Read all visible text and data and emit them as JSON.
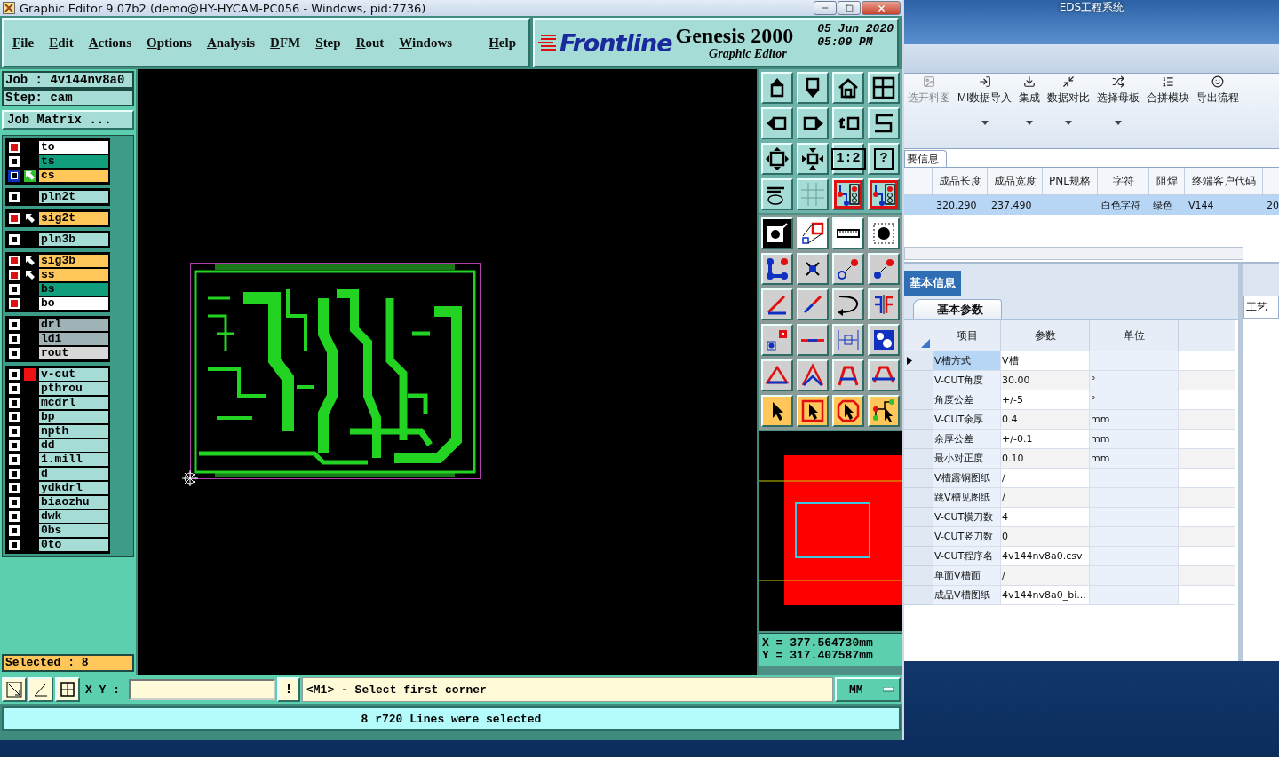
{
  "genesis": {
    "title": "Graphic Editor 9.07b2 (demo@HY-HYCAM-PC056 - Windows, pid:7736)",
    "menu": [
      "File",
      "Edit",
      "Actions",
      "Options",
      "Analysis",
      "DFM",
      "Step",
      "Rout",
      "Windows"
    ],
    "help": "Help",
    "brand": {
      "logo": "Frontline",
      "product": "Genesis 2000",
      "subtitle": "Graphic Editor",
      "date": "05 Jun 2020",
      "time": "05:09 PM"
    },
    "job": "Job : 4v144nv8a0",
    "step": "Step: cam",
    "job_matrix": "Job Matrix ...",
    "layer_groups": [
      {
        "layers": [
          {
            "name": "to",
            "checked": true,
            "affected": false,
            "work": false,
            "flagged": false,
            "color": "#ffffff"
          },
          {
            "name": "ts",
            "checked": false,
            "affected": false,
            "work": false,
            "flagged": false,
            "color": "#119e7c"
          },
          {
            "name": "cs",
            "checked": false,
            "affected": true,
            "work": true,
            "flagged": false,
            "color": "#ffc65a"
          }
        ]
      },
      {
        "layers": [
          {
            "name": "pln2t",
            "checked": false,
            "affected": false,
            "work": false,
            "flagged": false,
            "color": "#a6dcd6"
          }
        ]
      },
      {
        "layers": [
          {
            "name": "sig2t",
            "checked": true,
            "affected": true,
            "work": false,
            "flagged": false,
            "color": "#ffc65a"
          }
        ]
      },
      {
        "layers": [
          {
            "name": "pln3b",
            "checked": false,
            "affected": false,
            "work": false,
            "flagged": false,
            "color": "#a6dcd6"
          }
        ]
      },
      {
        "layers": [
          {
            "name": "sig3b",
            "checked": true,
            "affected": true,
            "work": false,
            "flagged": false,
            "color": "#ffc65a"
          },
          {
            "name": "ss",
            "checked": true,
            "affected": true,
            "work": false,
            "flagged": false,
            "color": "#ffc65a"
          },
          {
            "name": "bs",
            "checked": false,
            "affected": false,
            "work": false,
            "flagged": false,
            "color": "#119e7c"
          },
          {
            "name": "bo",
            "checked": true,
            "affected": false,
            "work": false,
            "flagged": false,
            "color": "#ffffff"
          }
        ]
      },
      {
        "layers": [
          {
            "name": "drl",
            "checked": false,
            "affected": false,
            "work": false,
            "flagged": false,
            "color": "#9fb2b6"
          },
          {
            "name": "ldi",
            "checked": false,
            "affected": false,
            "work": false,
            "flagged": false,
            "color": "#9fb2b6"
          },
          {
            "name": "rout",
            "checked": false,
            "affected": false,
            "work": false,
            "flagged": false,
            "color": "#d8d8d8"
          }
        ]
      },
      {
        "layers": [
          {
            "name": "v-cut",
            "checked": false,
            "affected": false,
            "work": false,
            "flagged": true,
            "color": "#a6dcd6"
          },
          {
            "name": "pthrou",
            "checked": false,
            "affected": false,
            "work": false,
            "flagged": false,
            "color": "#a6dcd6"
          },
          {
            "name": "mcdrl",
            "checked": false,
            "affected": false,
            "work": false,
            "flagged": false,
            "color": "#a6dcd6"
          },
          {
            "name": "bp",
            "checked": false,
            "affected": false,
            "work": false,
            "flagged": false,
            "color": "#a6dcd6"
          },
          {
            "name": "npth",
            "checked": false,
            "affected": false,
            "work": false,
            "flagged": false,
            "color": "#a6dcd6"
          },
          {
            "name": "dd",
            "checked": false,
            "affected": false,
            "work": false,
            "flagged": false,
            "color": "#a6dcd6"
          },
          {
            "name": "1.mill",
            "checked": false,
            "affected": false,
            "work": false,
            "flagged": false,
            "color": "#a6dcd6"
          },
          {
            "name": "d",
            "checked": false,
            "affected": false,
            "work": false,
            "flagged": false,
            "color": "#a6dcd6"
          },
          {
            "name": "ydkdrl",
            "checked": false,
            "affected": false,
            "work": false,
            "flagged": false,
            "color": "#a6dcd6"
          },
          {
            "name": "biaozhu",
            "checked": false,
            "affected": false,
            "work": false,
            "flagged": false,
            "color": "#a6dcd6"
          },
          {
            "name": "dwk",
            "checked": false,
            "affected": false,
            "work": false,
            "flagged": false,
            "color": "#a6dcd6"
          },
          {
            "name": "0bs",
            "checked": false,
            "affected": false,
            "work": false,
            "flagged": false,
            "color": "#a6dcd6"
          },
          {
            "name": "0to",
            "checked": false,
            "affected": false,
            "work": false,
            "flagged": false,
            "color": "#a6dcd6"
          }
        ]
      }
    ],
    "selected_count": "Selected : 8",
    "view_buttons": [
      {
        "active": false
      },
      {
        "active": false
      },
      {
        "active": false
      },
      {
        "active": false
      },
      {
        "active": false
      },
      {
        "active": false
      },
      {
        "active": false
      },
      {
        "active": false
      },
      {
        "active": false
      },
      {
        "active": false
      },
      {
        "active": false,
        "label": "1:2"
      },
      {
        "active": false,
        "label": "?"
      },
      {
        "active": false
      },
      {
        "active": false
      },
      {
        "active": true
      },
      {
        "active": true
      }
    ],
    "edit_buttons": [
      {
        "kind": "dark"
      },
      {
        "kind": "white"
      },
      {
        "kind": "white"
      },
      {
        "kind": "white"
      },
      {
        "kind": "plain"
      },
      {
        "kind": "plain"
      },
      {
        "kind": "plain"
      },
      {
        "kind": "plain"
      },
      {
        "kind": "plain"
      },
      {
        "kind": "plain"
      },
      {
        "kind": "plain"
      },
      {
        "kind": "plain"
      },
      {
        "kind": "plain"
      },
      {
        "kind": "plain"
      },
      {
        "kind": "plain"
      },
      {
        "kind": "plain"
      },
      {
        "kind": "plain"
      },
      {
        "kind": "plain"
      },
      {
        "kind": "plain"
      },
      {
        "kind": "plain"
      },
      {
        "kind": "select"
      },
      {
        "kind": "select"
      },
      {
        "kind": "select"
      },
      {
        "kind": "select"
      }
    ],
    "coords": {
      "x": "X = 377.564730mm",
      "y": "Y = 317.407587mm"
    },
    "command": {
      "xy_label": "X Y :",
      "bang": "!",
      "message": "<M1> - Select first corner",
      "units": "MM"
    },
    "status": "8 r720 Lines were selected"
  },
  "eds": {
    "title": "EDS工程系统",
    "ribbon": [
      {
        "label": "选开料图",
        "disabled": true,
        "dropdown": false
      },
      {
        "label": "MI数据导入",
        "disabled": false,
        "dropdown": true
      },
      {
        "label": "集成",
        "disabled": false,
        "dropdown": true
      },
      {
        "label": "数据对比",
        "disabled": false,
        "dropdown": true
      },
      {
        "label": "选择母板",
        "disabled": false,
        "dropdown": true
      },
      {
        "label": "合拼模块",
        "disabled": false,
        "dropdown": false
      },
      {
        "label": "导出流程",
        "disabled": false,
        "dropdown": false
      }
    ],
    "summary_tab": "要信息",
    "summary_table": {
      "columns": [
        "成品长度",
        "成品宽度",
        "PNL规格",
        "字符",
        "阻焊",
        "终端客户代码"
      ],
      "rows": [
        {
          "selected": true,
          "cells": [
            "320.290",
            "237.490",
            null,
            "白色字符",
            "绿色",
            "V144",
            "20"
          ]
        }
      ]
    },
    "panel_tab": "基本信息",
    "sub_tab": "基本参数",
    "params": {
      "columns": [
        "项目",
        "参数",
        "单位"
      ],
      "rows": [
        {
          "item": "V槽方式",
          "value": "V槽",
          "current": true
        },
        {
          "item": "V-CUT角度",
          "value": "30.00",
          "unit": "°",
          "current": false
        },
        {
          "item": "角度公差",
          "value": "+/-5",
          "unit": "°",
          "current": false
        },
        {
          "item": "V-CUT余厚",
          "value": "0.4",
          "unit": "mm",
          "current": false
        },
        {
          "item": "余厚公差",
          "value": "+/-0.1",
          "unit": "mm",
          "current": false
        },
        {
          "item": "最小对正度",
          "value": "0.10",
          "unit": "mm",
          "current": false
        },
        {
          "item": "V槽露铜图纸",
          "value": "/",
          "current": false
        },
        {
          "item": "跳V槽见图纸",
          "value": "/",
          "current": false
        },
        {
          "item": "V-CUT横刀数",
          "value": "4",
          "current": false
        },
        {
          "item": "V-CUT竖刀数",
          "value": "0",
          "current": false
        },
        {
          "item": "V-CUT程序名",
          "value": "4v144nv8a0.csv",
          "current": false
        },
        {
          "item": "单面V槽面",
          "value": "/",
          "current": false
        },
        {
          "item": "成品V槽图纸",
          "value": "4v144nv8a0_bi...",
          "current": false
        }
      ]
    },
    "side_tab": "工艺"
  }
}
